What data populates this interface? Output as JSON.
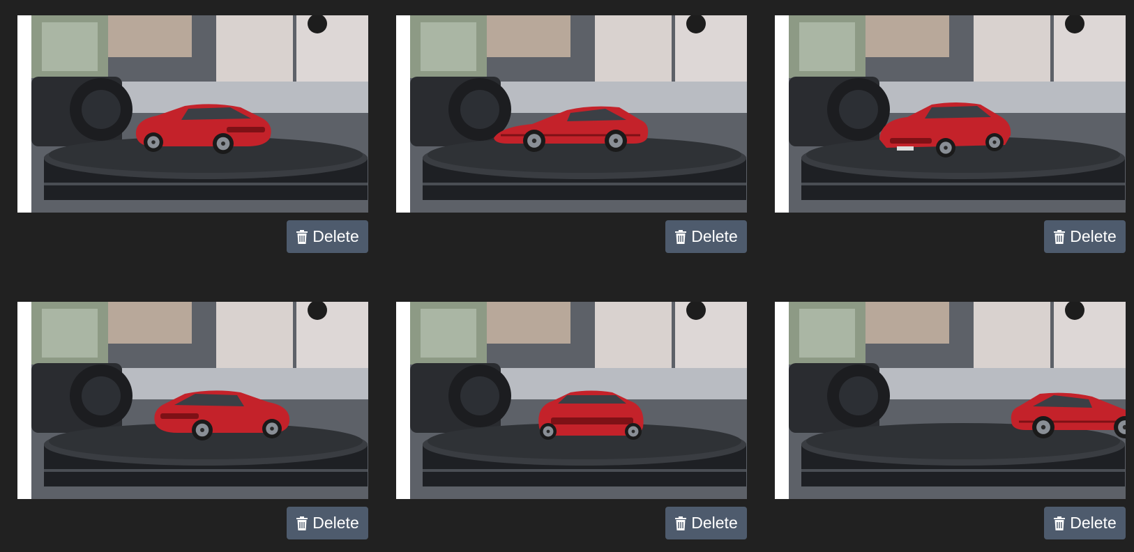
{
  "colors": {
    "background": "#212121",
    "button": "#4e5b6d",
    "button_text": "#ffffff",
    "car": "#c4222a"
  },
  "gallery": {
    "items": [
      {
        "image": "red toy sports car on turntable, rear three-quarter view",
        "car_view": "rear-left",
        "delete_label": "Delete",
        "delete_icon": "trash-icon"
      },
      {
        "image": "red toy sports car on turntable, side profile view",
        "car_view": "side-left",
        "delete_label": "Delete",
        "delete_icon": "trash-icon"
      },
      {
        "image": "red toy sports car on turntable, front three-quarter view",
        "car_view": "front-left",
        "delete_label": "Delete",
        "delete_icon": "trash-icon"
      },
      {
        "image": "red toy sports car on turntable, rear three-quarter view",
        "car_view": "rear-right",
        "delete_label": "Delete",
        "delete_icon": "trash-icon"
      },
      {
        "image": "red toy sports car on turntable, rear view",
        "car_view": "rear",
        "delete_label": "Delete",
        "delete_icon": "trash-icon"
      },
      {
        "image": "red toy sports car on turntable, side profile view",
        "car_view": "side-right",
        "delete_label": "Delete",
        "delete_icon": "trash-icon"
      }
    ]
  }
}
